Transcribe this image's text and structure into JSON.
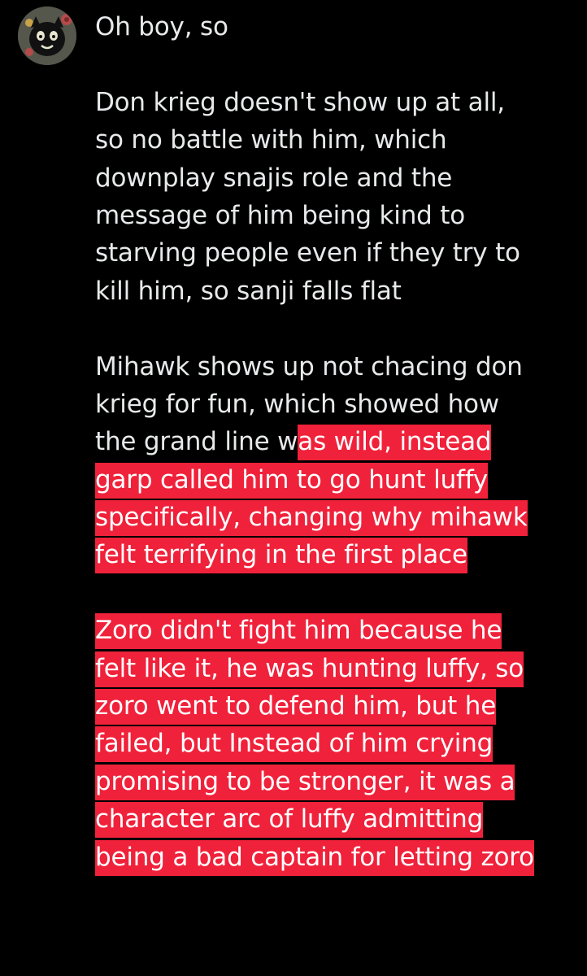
{
  "post": {
    "lines": [
      [
        {
          "t": "Oh boy, so",
          "h": false
        }
      ],
      [],
      [
        {
          "t": "Don krieg doesn't show up at all,",
          "h": false
        }
      ],
      [
        {
          "t": "so no battle with him, which",
          "h": false
        }
      ],
      [
        {
          "t": "downplay snajis role and the",
          "h": false
        }
      ],
      [
        {
          "t": "message of him being kind to",
          "h": false
        }
      ],
      [
        {
          "t": "starving people even if they try to",
          "h": false
        }
      ],
      [
        {
          "t": "kill him, so sanji falls flat",
          "h": false
        }
      ],
      [],
      [
        {
          "t": "Mihawk shows up not chacing don",
          "h": false
        }
      ],
      [
        {
          "t": "krieg for fun, which showed how",
          "h": false
        }
      ],
      [
        {
          "t": "the grand line w",
          "h": false
        },
        {
          "t": "as wild, instead",
          "h": true
        }
      ],
      [
        {
          "t": "garp called him to go hunt luffy",
          "h": true
        }
      ],
      [
        {
          "t": "specifically, changing why mihawk",
          "h": true
        }
      ],
      [
        {
          "t": "felt terrifying in the first place",
          "h": true
        }
      ],
      [],
      [
        {
          "t": "Zoro didn't fight him because he",
          "h": true
        }
      ],
      [
        {
          "t": "felt like it, he was hunting luffy, so",
          "h": true
        }
      ],
      [
        {
          "t": "zoro went to defend him, but he",
          "h": true
        }
      ],
      [
        {
          "t": "failed, but Instead of him crying",
          "h": true
        }
      ],
      [
        {
          "t": "promising to be stronger, it was a",
          "h": true
        }
      ],
      [
        {
          "t": "character arc of luffy admitting",
          "h": true
        }
      ],
      [
        {
          "t": "being a bad captain for letting zoro",
          "h": true
        }
      ]
    ]
  },
  "colors": {
    "background": "#000000",
    "text": "#e7e9ea",
    "highlight": "#f0213a",
    "highlight_text": "#ffffff"
  },
  "icons": {
    "avatar": "avatar-character-icon"
  }
}
